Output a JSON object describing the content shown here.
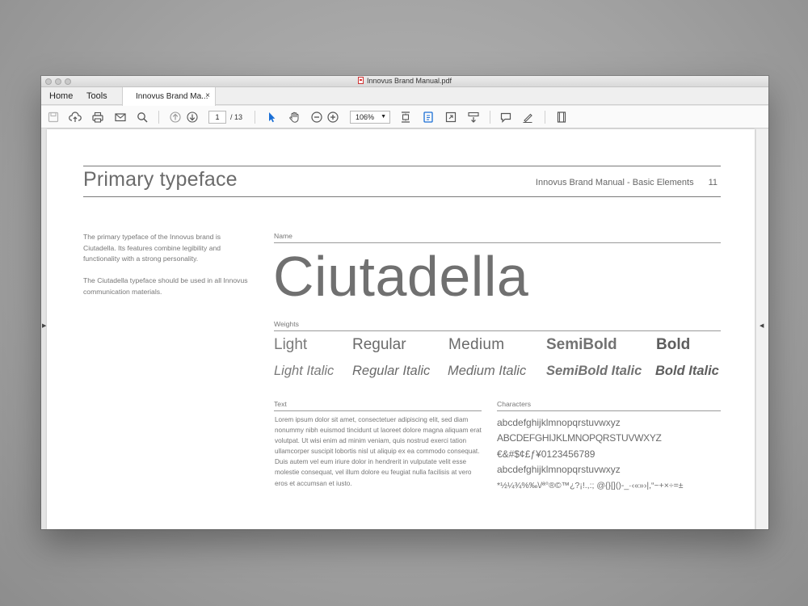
{
  "window": {
    "title": "Innovus Brand Manual.pdf"
  },
  "menu": {
    "home": "Home",
    "tools": "Tools",
    "tab_label": "Innovus Brand Ma...",
    "tab_close": "×"
  },
  "toolbar": {
    "page_current": "1",
    "page_total": "/ 13",
    "zoom": "106%",
    "icons": [
      "save-icon",
      "upload-icon",
      "print-icon",
      "mail-icon",
      "search-icon",
      "page-up-icon",
      "page-down-icon",
      "select-arrow-icon",
      "hand-icon",
      "zoom-out-icon",
      "zoom-in-icon",
      "fit-page-icon",
      "page-view-icon",
      "fullscreen-icon",
      "scroll-mode-icon",
      "comment-icon",
      "sign-icon",
      "filmstrip-icon"
    ]
  },
  "page": {
    "title": "Primary typeface",
    "header": "Innovus Brand Manual - Basic Elements",
    "page_number": "11",
    "intro": [
      "The primary typeface of the Innovus brand is Ciutadella. Its features combine legibility and functionality with a strong personality.",
      "The Ciutadella typeface should be used in all Innovus communication materials."
    ],
    "name_label": "Name",
    "specimen": "Ciutadella",
    "weights_label": "Weights",
    "weights": {
      "upright": [
        "Light",
        "Regular",
        "Medium",
        "SemiBold",
        "Bold"
      ],
      "italic": [
        "Light Italic",
        "Regular Italic",
        "Medium Italic",
        "SemiBold Italic",
        "Bold Italic"
      ]
    },
    "text_label": "Text",
    "text_body": "Lorem ipsum dolor sit amet, consectetuer adipiscing elit, sed diam nonummy nibh euismod tincidunt ut laoreet dolore magna aliquam erat volutpat. Ut wisi enim ad minim veniam, quis nostrud exerci tation ullamcorper suscipit lobortis nisl ut aliquip ex ea commodo consequat. Duis autem vel eum iriure dolor in hendrerit in vulputate velit esse molestie consequat, vel illum dolore eu feugiat nulla facilisis at vero eros et accumsan et iusto.",
    "characters_label": "Characters",
    "characters": [
      "abcdefghijklmnopqrstuvwxyz",
      "ABCDEFGHIJKLMNOPQRSTUVWXYZ",
      "€&#$¢£ƒ¥0123456789",
      "abcdefghijklmnopqrstuvwxyz",
      "*½¼¾%‰\\/ª°®©™¿?¡!.,:; @{}[]()-_·‹«»›|,“~+×÷=±"
    ]
  },
  "colors": {
    "accent": "#1a6fd6"
  }
}
